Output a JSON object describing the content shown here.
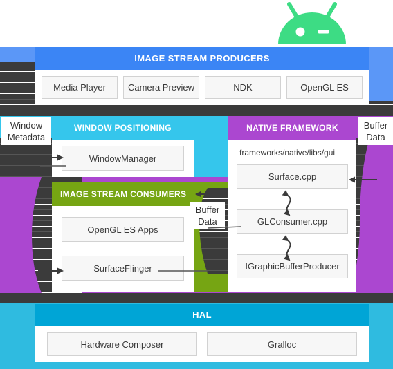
{
  "logo": {
    "name": "android-robot-logo",
    "color": "#3ddc84"
  },
  "colors": {
    "producers": "#3b85f5",
    "producers_light": "#5b97f7",
    "window_positioning": "#35c6ec",
    "consumers": "#76a513",
    "native_framework": "#ab47d0",
    "hal": "#00a5d6",
    "pipe": "#3b3b3b",
    "box_fill": "#f7f7f7",
    "box_border": "#d2d2d2"
  },
  "sections": {
    "producers": {
      "title": "IMAGE STREAM PRODUCERS",
      "items": [
        "Media Player",
        "Camera Preview",
        "NDK",
        "OpenGL ES"
      ]
    },
    "window_positioning": {
      "title": "WINDOW POSITIONING",
      "items": [
        "WindowManager"
      ]
    },
    "consumers": {
      "title": "IMAGE STREAM CONSUMERS",
      "items": [
        "OpenGL ES Apps",
        "SurfaceFlinger"
      ]
    },
    "native_framework": {
      "title": "NATIVE FRAMEWORK",
      "path": "frameworks/native/libs/gui",
      "items": [
        "Surface.cpp",
        "GLConsumer.cpp",
        "IGraphicBufferProducer"
      ]
    },
    "hal": {
      "title": "HAL",
      "items": [
        "Hardware Composer",
        "Gralloc"
      ]
    }
  },
  "labels": {
    "window_metadata": "Window\nMetadata",
    "window_metadata_l1": "Window",
    "window_metadata_l2": "Metadata",
    "buffer_data_l1": "Buffer",
    "buffer_data_l2": "Data",
    "buffer_data_right_l1": "Buffer",
    "buffer_data_right_l2": "Data"
  }
}
